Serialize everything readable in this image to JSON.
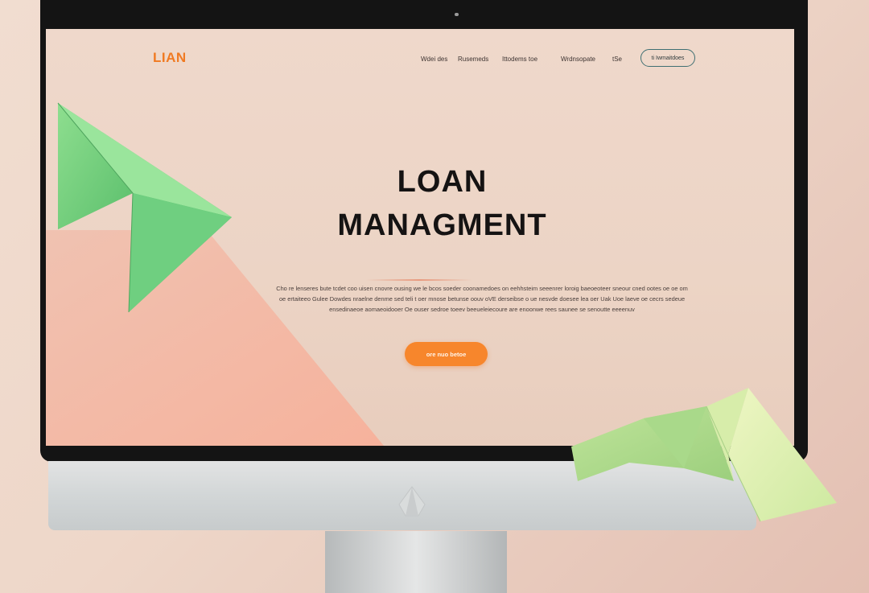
{
  "nav": {
    "logo": "LIAN",
    "links": [
      "Wdei des",
      "Rusemeds",
      "Ittodems toe",
      "Wrdnsopate",
      "tSe"
    ],
    "cta_label": "ti Iwmaitdoes"
  },
  "hero": {
    "title_line1": "LOAN",
    "title_line2": "MANAGMENT",
    "description": "Cho re lenseres bute tcdet coo uisen cnovre ousing we le bcos soeder coonamedoes on eehhsteim seeenrer loroig baeoeoteer sneour cned ootes oe oe om oe ertaiteeo Gulee Dowdes nraelne denme sed teli t oer mnose betunse oouv oVE derseibse o ue nesvde doesee lea oer Uak Uoe laeve oe cecrs sedeue ensedinaeoe aomaeoidooer Oe ouser sedroe toeev beeueleiecoure are enoonwe rees saunee se senoutte eeeenuv",
    "cta_label": "ore nuo betoe"
  },
  "colors": {
    "accent_orange": "#f7862c",
    "logo_orange": "#f07a22",
    "outline_teal": "#3f6f72",
    "bezel": "#141414",
    "paper_green": "#7fd58a",
    "paper_lime": "#dbf0b0",
    "peach": "#f4b5a0"
  },
  "icons": {
    "apple_logo": "apple-logo-icon",
    "camera": "camera-dot-icon"
  }
}
